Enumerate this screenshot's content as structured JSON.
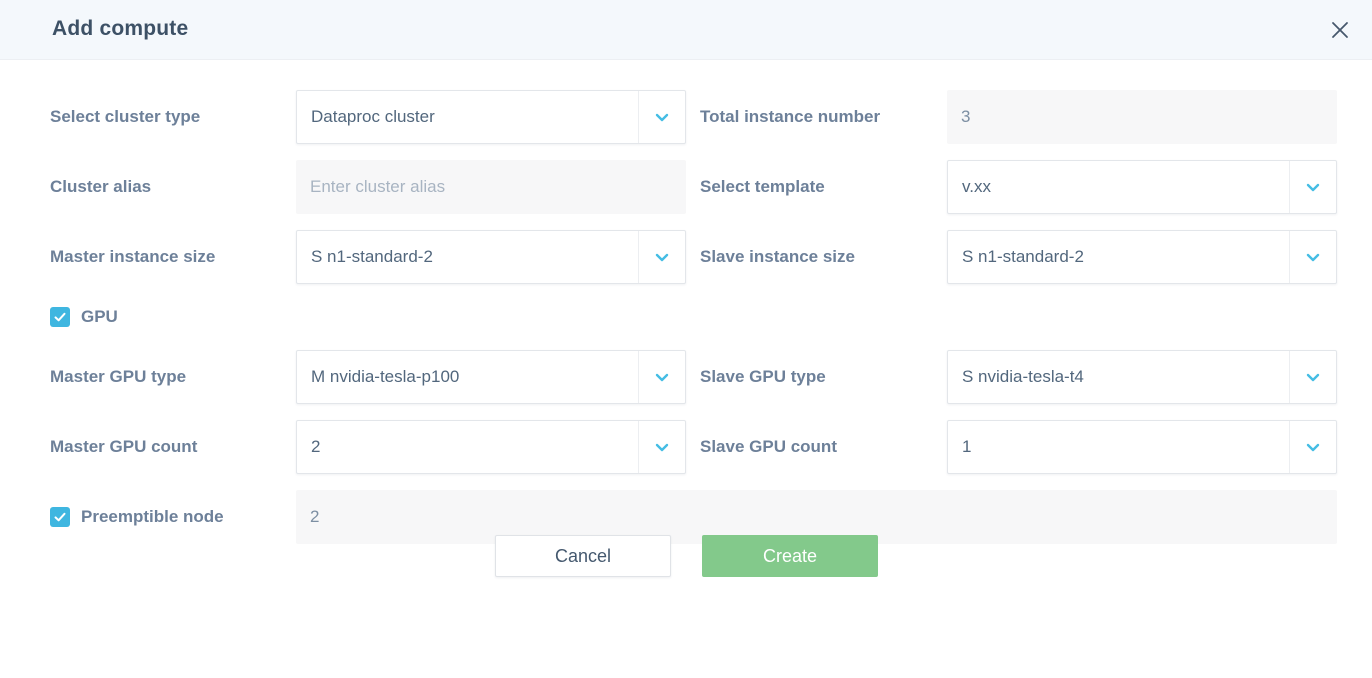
{
  "dialog": {
    "title": "Add compute",
    "close_icon": "close-icon"
  },
  "form": {
    "cluster_type": {
      "label": "Select cluster type",
      "value": "Dataproc cluster",
      "icon": "chevron-down-icon"
    },
    "total_instance_number": {
      "label": "Total instance number",
      "value": "3"
    },
    "cluster_alias": {
      "label": "Cluster alias",
      "value": "",
      "placeholder": "Enter cluster alias"
    },
    "template": {
      "label": "Select template",
      "value": "v.xx",
      "icon": "chevron-down-icon"
    },
    "master_instance_size": {
      "label": "Master instance size",
      "value": "S n1-standard-2",
      "icon": "chevron-down-icon"
    },
    "slave_instance_size": {
      "label": "Slave instance size",
      "value": "S n1-standard-2",
      "icon": "chevron-down-icon"
    },
    "gpu_checkbox": {
      "label": "GPU",
      "checked": true,
      "icon": "check-icon"
    },
    "master_gpu_type": {
      "label": "Master GPU type",
      "value": "M nvidia-tesla-p100",
      "icon": "chevron-down-icon"
    },
    "slave_gpu_type": {
      "label": "Slave GPU type",
      "value": "S nvidia-tesla-t4",
      "icon": "chevron-down-icon"
    },
    "master_gpu_count": {
      "label": "Master GPU count",
      "value": "2",
      "icon": "chevron-down-icon"
    },
    "slave_gpu_count": {
      "label": "Slave GPU count",
      "value": "1",
      "icon": "chevron-down-icon"
    },
    "preemptible_node": {
      "label": "Preemptible node",
      "checked": true,
      "icon": "check-icon",
      "value": "2"
    }
  },
  "footer": {
    "cancel_label": "Cancel",
    "create_label": "Create"
  },
  "colors": {
    "header_bg": "#f4f8fc",
    "label_text": "#6d8099",
    "value_text": "#52677d",
    "accent_blue": "#3fb6e0",
    "create_green": "#83c98b",
    "disabled_bg": "#f7f7f8"
  }
}
